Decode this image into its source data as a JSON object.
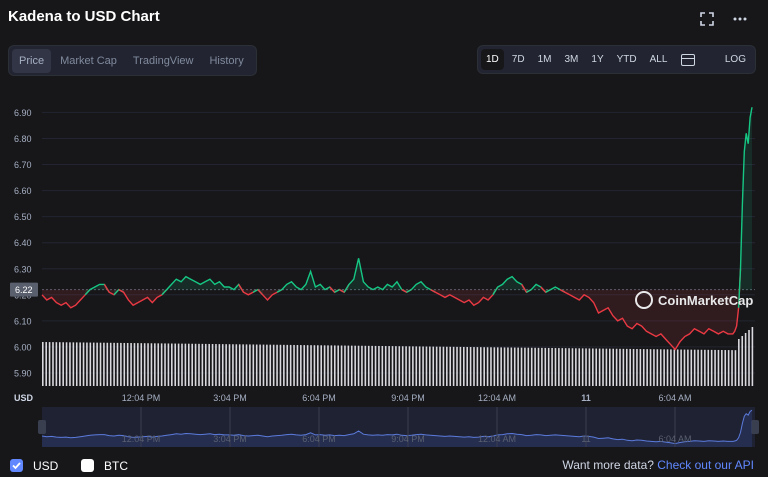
{
  "header": {
    "title": "Kadena to USD Chart",
    "fullscreen_icon": "fullscreen-icon",
    "more_icon": "more-icon"
  },
  "tabs": [
    "Price",
    "Market Cap",
    "TradingView",
    "History"
  ],
  "active_tab": "Price",
  "ranges": [
    "1D",
    "7D",
    "1M",
    "3M",
    "1Y",
    "YTD",
    "ALL"
  ],
  "active_range": "1D",
  "log_label": "LOG",
  "watermark": "CoinMarketCap",
  "chart_data": {
    "type": "line",
    "y_ticks": [
      "6.90",
      "6.80",
      "6.70",
      "6.60",
      "6.50",
      "6.40",
      "6.30",
      "6.20",
      "6.10",
      "6.00",
      "5.90"
    ],
    "ylim": [
      5.85,
      6.94
    ],
    "x_ticks": [
      "12:04 PM",
      "3:04 PM",
      "6:04 PM",
      "9:04 PM",
      "12:04 AM",
      "11",
      "6:04 AM"
    ],
    "y_unit_label": "USD",
    "current_price_label": "6.22",
    "reference_price": 6.22,
    "series": [
      {
        "x": [
          0,
          5,
          10,
          15,
          20,
          25,
          30,
          35,
          40,
          45,
          50,
          55,
          60,
          65,
          70,
          75,
          80,
          85,
          90,
          95,
          100,
          105,
          110,
          115,
          120,
          125,
          130,
          135,
          140,
          145,
          150,
          155,
          160,
          165,
          170,
          175,
          180,
          185,
          190,
          195,
          200,
          205,
          210,
          215,
          220,
          225,
          230,
          235,
          240,
          245,
          250,
          255,
          260,
          265,
          270,
          275,
          280,
          285,
          290,
          295,
          300,
          305,
          310,
          315,
          320,
          325,
          330,
          335,
          340,
          345,
          350,
          355,
          360,
          365,
          370,
          375,
          380,
          385,
          390,
          395,
          400,
          405,
          410,
          415,
          420,
          425,
          430,
          435,
          440,
          445,
          450,
          455,
          460,
          465,
          470,
          475,
          480,
          485,
          490,
          495,
          500,
          505,
          510,
          515,
          520,
          525,
          530,
          535,
          540,
          545,
          550,
          555,
          560,
          565,
          570,
          575,
          580,
          585,
          590,
          595,
          600,
          605,
          610,
          615,
          620,
          625,
          630,
          635,
          640,
          645,
          650,
          655,
          660,
          665,
          670,
          675,
          680,
          685,
          690,
          695,
          700,
          705,
          710,
          715,
          720,
          722,
          724,
          726,
          728,
          730,
          732,
          734,
          736,
          738,
          740
        ],
        "values": [
          6.2,
          6.18,
          6.19,
          6.17,
          6.16,
          6.17,
          6.15,
          6.16,
          6.18,
          6.2,
          6.22,
          6.23,
          6.24,
          6.24,
          6.21,
          6.2,
          6.22,
          6.21,
          6.18,
          6.16,
          6.17,
          6.18,
          6.19,
          6.17,
          6.19,
          6.2,
          6.22,
          6.24,
          6.26,
          6.25,
          6.27,
          6.26,
          6.25,
          6.24,
          6.25,
          6.26,
          6.24,
          6.25,
          6.23,
          6.23,
          6.22,
          6.24,
          6.21,
          6.2,
          6.21,
          6.22,
          6.2,
          6.18,
          6.2,
          6.21,
          6.22,
          6.24,
          6.25,
          6.23,
          6.22,
          6.24,
          6.29,
          6.23,
          6.24,
          6.22,
          6.23,
          6.21,
          6.22,
          6.21,
          6.24,
          6.26,
          6.34,
          6.25,
          6.23,
          6.22,
          6.23,
          6.22,
          6.24,
          6.23,
          6.25,
          6.22,
          6.21,
          6.22,
          6.24,
          6.25,
          6.23,
          6.22,
          6.21,
          6.2,
          6.19,
          6.2,
          6.19,
          6.18,
          6.17,
          6.18,
          6.16,
          6.17,
          6.19,
          6.18,
          6.2,
          6.23,
          6.24,
          6.26,
          6.27,
          6.25,
          6.24,
          6.21,
          6.22,
          6.24,
          6.23,
          6.21,
          6.22,
          6.23,
          6.22,
          6.21,
          6.2,
          6.19,
          6.18,
          6.2,
          6.19,
          6.17,
          6.13,
          6.14,
          6.15,
          6.12,
          6.1,
          6.11,
          6.08,
          6.07,
          6.09,
          6.08,
          6.06,
          6.05,
          6.04,
          6.05,
          6.03,
          6.01,
          5.99,
          6.02,
          6.04,
          6.05,
          6.07,
          6.06,
          6.05,
          6.07,
          6.06,
          6.05,
          6.06,
          6.05,
          6.05,
          6.06,
          6.08,
          6.15,
          6.3,
          6.55,
          6.75,
          6.82,
          6.78,
          6.88,
          6.92
        ]
      }
    ],
    "volume_bar_count": 210
  },
  "footer": {
    "usd_label": "USD",
    "btc_label": "BTC",
    "more_data_text": "Want more data?",
    "api_link": "Check out our API"
  },
  "colors": {
    "up": "#16c784",
    "down": "#ea3943",
    "bg": "#17171a",
    "accent": "#6188ff"
  }
}
